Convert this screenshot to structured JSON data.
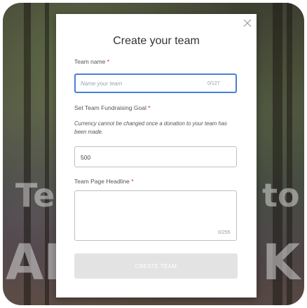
{
  "background": {
    "text_line1_left": "Te",
    "text_line1_right": "to",
    "text_line2_left": "AK",
    "text_line2_right": "K"
  },
  "modal": {
    "title": "Create your team",
    "close_icon": "close-icon",
    "team_name": {
      "label": "Team name",
      "required_mark": "*",
      "placeholder": "Name your team",
      "counter": "0/127"
    },
    "goal": {
      "label": "Set Team Fundraising Goal",
      "required_mark": "*",
      "note": "Currency cannot be changed once a donation to your team has been made.",
      "value": "500"
    },
    "headline": {
      "label": "Team Page Headline",
      "required_mark": "*",
      "counter": "0/255"
    },
    "submit_label": "CREATE TEAM"
  },
  "colors": {
    "focus_border": "#4a7fd6",
    "required": "#e02424",
    "button_disabled": "#e3e3e3"
  }
}
